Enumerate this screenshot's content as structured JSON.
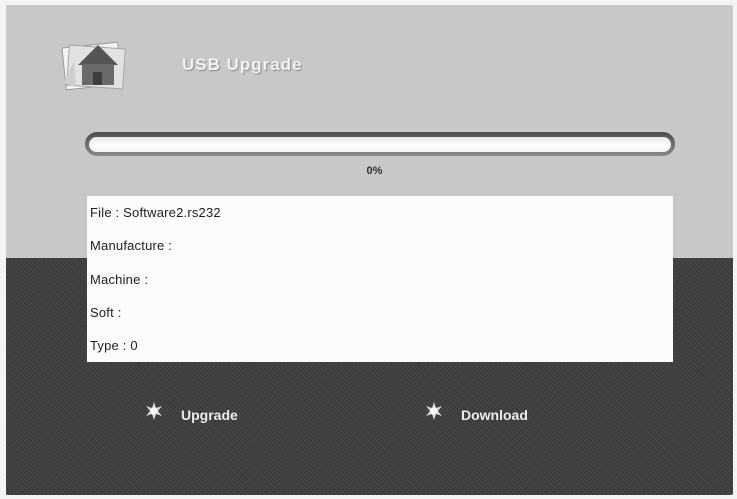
{
  "header": {
    "title": "USB Upgrade",
    "icon": "house-folder-icon"
  },
  "progress": {
    "percent_text": "0%",
    "value": 0
  },
  "info": {
    "file": "File : Software2.rs232",
    "manufacture": "Manufacture :",
    "machine": "Machine :",
    "soft": "Soft :",
    "type": "Type : 0"
  },
  "actions": {
    "upgrade": {
      "label": "Upgrade",
      "icon": "star-burst-icon"
    },
    "download": {
      "label": "Download",
      "icon": "star-burst-icon"
    }
  },
  "colors": {
    "panel_top": "#c8c8c8",
    "panel_bottom": "#3f3f3f",
    "info_bg": "#fcfcfc"
  }
}
